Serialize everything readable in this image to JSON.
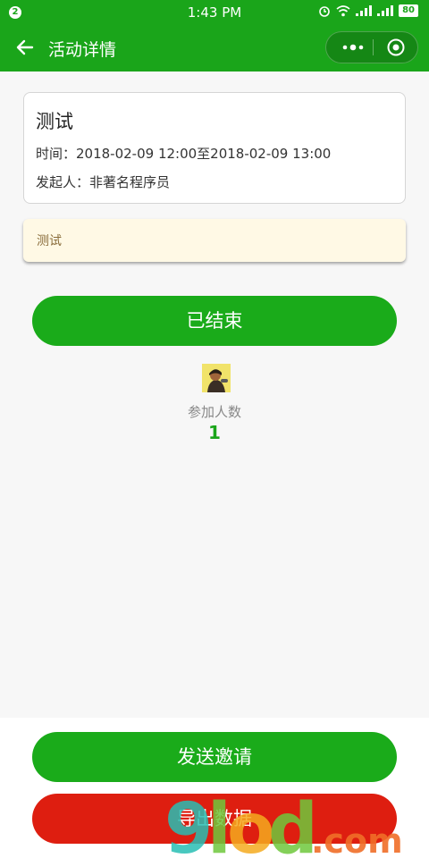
{
  "status_bar": {
    "notification_count": "2",
    "time": "1:43 PM",
    "battery": "80"
  },
  "navbar": {
    "title": "活动详情"
  },
  "event": {
    "title": "测试",
    "time_line": "时间：2018-02-09 12:00至2018-02-09 13:00",
    "organizer_line": "发起人：非著名程序员",
    "note": "测试"
  },
  "status_button": "已结束",
  "participants": {
    "label": "参加人数",
    "count": "1"
  },
  "actions": {
    "invite": "发送邀请",
    "export": "导出数据"
  },
  "watermark": {
    "text": "9lod.com"
  },
  "colors": {
    "brand_green": "#1aa51a",
    "export_red": "#de1e10",
    "note_bg": "#fff9e5"
  }
}
